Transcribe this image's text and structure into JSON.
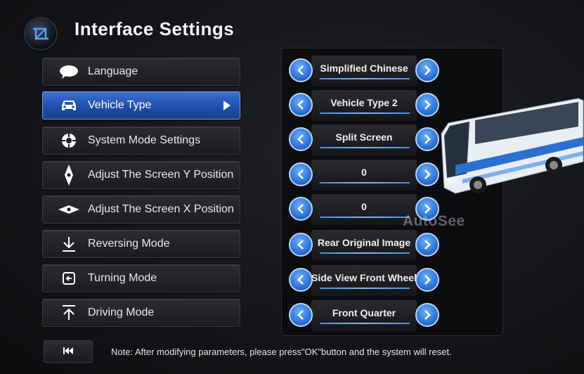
{
  "header": {
    "title": "Interface Settings",
    "icon": "crop-icon"
  },
  "menu": {
    "items": [
      {
        "label": "Language",
        "icon": "speech-bubble-icon",
        "active": false
      },
      {
        "label": "Vehicle Type",
        "icon": "car-icon",
        "active": true
      },
      {
        "label": "System Mode Settings",
        "icon": "gear-icon",
        "active": false
      },
      {
        "label": "Adjust The Screen Y Position",
        "icon": "vertical-diamond-icon",
        "active": false
      },
      {
        "label": "Adjust The Screen X Position",
        "icon": "horizontal-diamond-icon",
        "active": false
      },
      {
        "label": "Reversing Mode",
        "icon": "down-arrow-icon",
        "active": false
      },
      {
        "label": "Turning Mode",
        "icon": "turn-icon",
        "active": false
      },
      {
        "label": "Driving Mode",
        "icon": "up-arrow-icon",
        "active": false
      }
    ]
  },
  "settings": {
    "values": [
      "Simplified Chinese",
      "Vehicle Type 2",
      "Split Screen",
      "0",
      "0",
      "Rear Original Image",
      "Side View Front Wheel",
      "Front Quarter"
    ]
  },
  "watermark": "AutoSee",
  "footer": {
    "back_icon": "skip-back-icon",
    "note": "Note: After modifying parameters, please press\"OK\"button and the system will reset."
  },
  "colors": {
    "accent": "#2a73d8",
    "active_item": "#1d4ea8",
    "background": "#141518"
  }
}
